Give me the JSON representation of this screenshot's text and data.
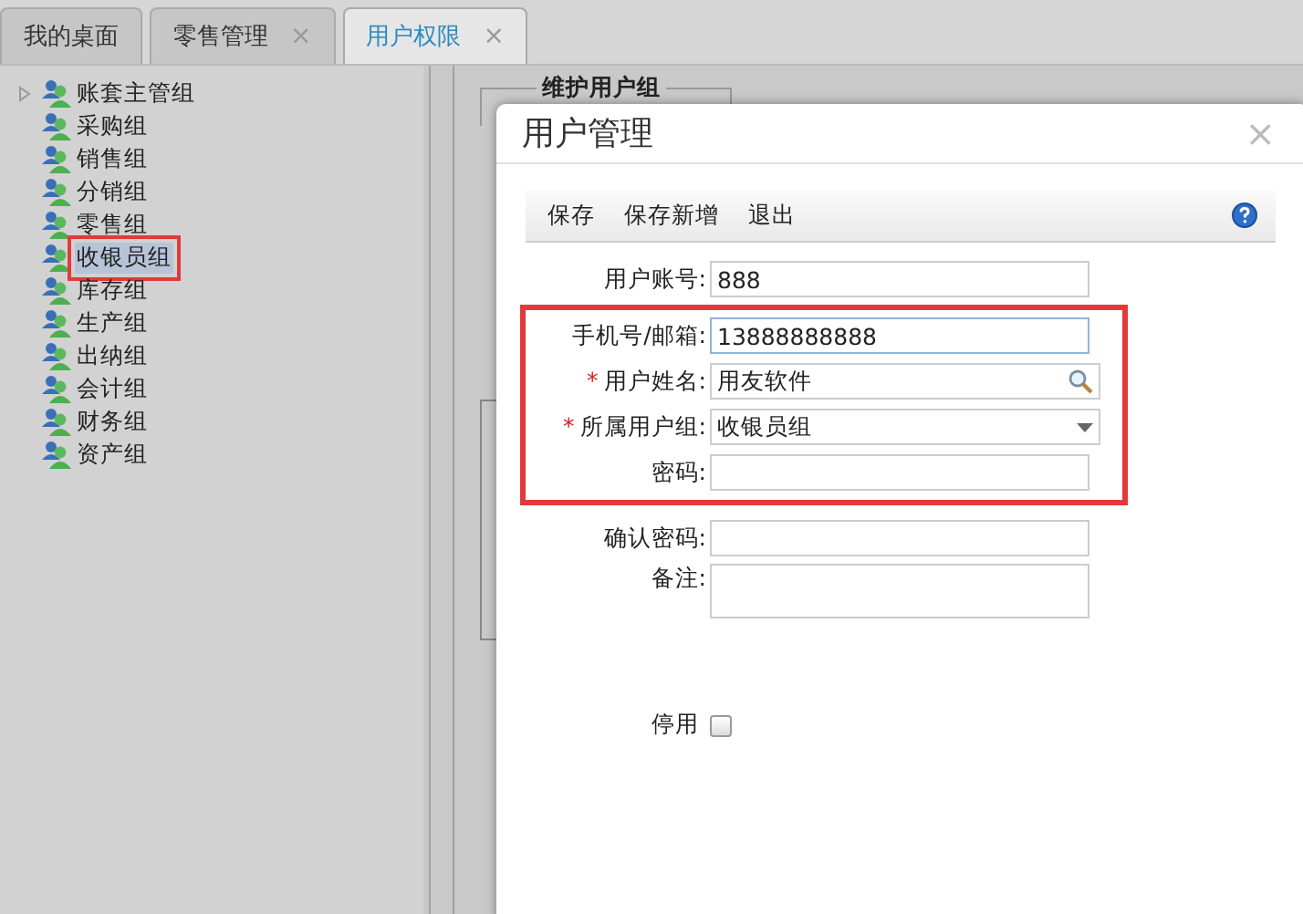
{
  "tabs": [
    {
      "label": "我的桌面",
      "selected": false
    },
    {
      "label": "零售管理",
      "close": "×",
      "selected": false
    },
    {
      "label": "用户权限",
      "close": "×",
      "selected": true
    }
  ],
  "tree": [
    {
      "label": "账套主管组",
      "expanded": false,
      "selected": false
    },
    {
      "label": "采购组",
      "selected": false
    },
    {
      "label": "销售组",
      "selected": false
    },
    {
      "label": "分销组",
      "selected": false
    },
    {
      "label": "零售组",
      "selected": false
    },
    {
      "label": "收银员组",
      "selected": true
    },
    {
      "label": "库存组",
      "selected": false
    },
    {
      "label": "生产组",
      "selected": false
    },
    {
      "label": "出纳组",
      "selected": false
    },
    {
      "label": "会计组",
      "selected": false
    },
    {
      "label": "财务组",
      "selected": false
    },
    {
      "label": "资产组",
      "selected": false
    }
  ],
  "group_panel": {
    "title": "维护用户组"
  },
  "dialog": {
    "title": "用户管理",
    "close_glyph": "×",
    "toolbar": [
      "保存",
      "保存新增",
      "退出"
    ],
    "fields": [
      {
        "kind": "text",
        "label": "用户账号:",
        "value": "888",
        "highlighted": false,
        "focused": false
      },
      {
        "kind": "text",
        "label": "手机号/邮箱:",
        "value": "13888888888",
        "highlighted": true,
        "focused": true
      },
      {
        "kind": "search",
        "label": "用户姓名:",
        "required_mark": "*",
        "value": "用友软件",
        "highlighted": true,
        "focused": false
      },
      {
        "kind": "select",
        "label": "所属用户组:",
        "required_mark": "*",
        "value": "收银员组",
        "highlighted": true,
        "focused": false
      },
      {
        "kind": "text",
        "label": "密码:",
        "highlighted": true,
        "focused": false
      },
      {
        "kind": "text",
        "label": "确认密码:",
        "highlighted": false,
        "focused": false
      },
      {
        "kind": "textarea",
        "label": "备注:",
        "highlighted": false,
        "focused": false
      }
    ],
    "disable": {
      "label": "停用",
      "checked": false
    }
  }
}
